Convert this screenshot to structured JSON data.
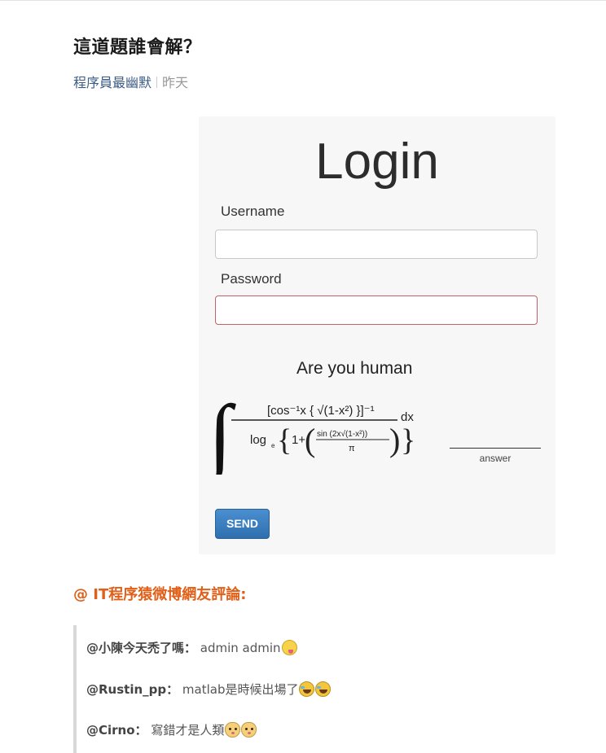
{
  "article": {
    "title": "這道題誰會解？",
    "author": "程序員最幽默",
    "time": "昨天"
  },
  "login_image": {
    "heading": "Login",
    "username_label": "Username",
    "username_value": "",
    "password_label": "Password",
    "password_value": "",
    "captcha_prompt": "Are you human",
    "formula": {
      "numerator": "[cos⁻¹x { √(1-x²) }]⁻¹",
      "log": "log",
      "log_base": "e",
      "one_plus": "1+",
      "inner_num": "sin (2x√(1-x²))",
      "inner_den": "π",
      "dx": "dx"
    },
    "answer_label": "answer",
    "send_label": "SEND",
    "colors": {
      "send_button": "#2f6fae",
      "error_border": "#c0626a"
    }
  },
  "comments_section": {
    "heading": "@ IT程序猿微博網友評論:",
    "heading_color": "#e0601a",
    "comments": [
      {
        "user": "@小陳今天禿了嗎：",
        "text": " admin admin",
        "emoji": [
          "tongue-face-icon"
        ]
      },
      {
        "user": "@Rustin_pp：",
        "text": " matlab是時候出場了",
        "emoji": [
          "laughing-tears-icon",
          "laughing-tears-icon"
        ]
      },
      {
        "user": "@Cirno：",
        "text": " 寫錯才是人類",
        "emoji": [
          "cat-face-icon",
          "cat-face-icon"
        ]
      }
    ]
  }
}
